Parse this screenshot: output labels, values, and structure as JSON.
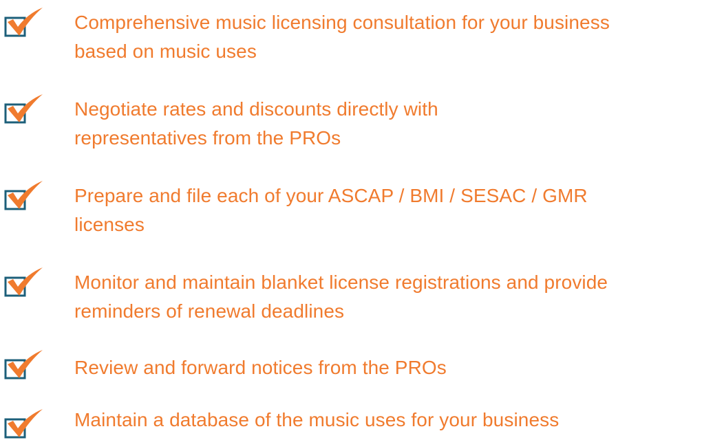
{
  "colors": {
    "accent": "#f07b2e",
    "box_border": "#1c5f7a",
    "background": "#ffffff"
  },
  "checklist": {
    "icon": "checkbox-checked-icon",
    "items": [
      {
        "lines": [
          "Comprehensive music licensing consultation for your business",
          "based on music uses"
        ]
      },
      {
        "lines": [
          "Negotiate rates and discounts directly with",
          "representatives from the PROs"
        ]
      },
      {
        "lines": [
          "Prepare and file each of your ASCAP / BMI / SESAC / GMR",
          "licenses"
        ]
      },
      {
        "lines": [
          "Monitor and maintain blanket license registrations and provide",
          "reminders of renewal deadlines"
        ]
      },
      {
        "lines": [
          "Review and forward notices from the PROs"
        ]
      },
      {
        "lines": [
          "Maintain a database of the music uses for your business"
        ]
      }
    ]
  }
}
